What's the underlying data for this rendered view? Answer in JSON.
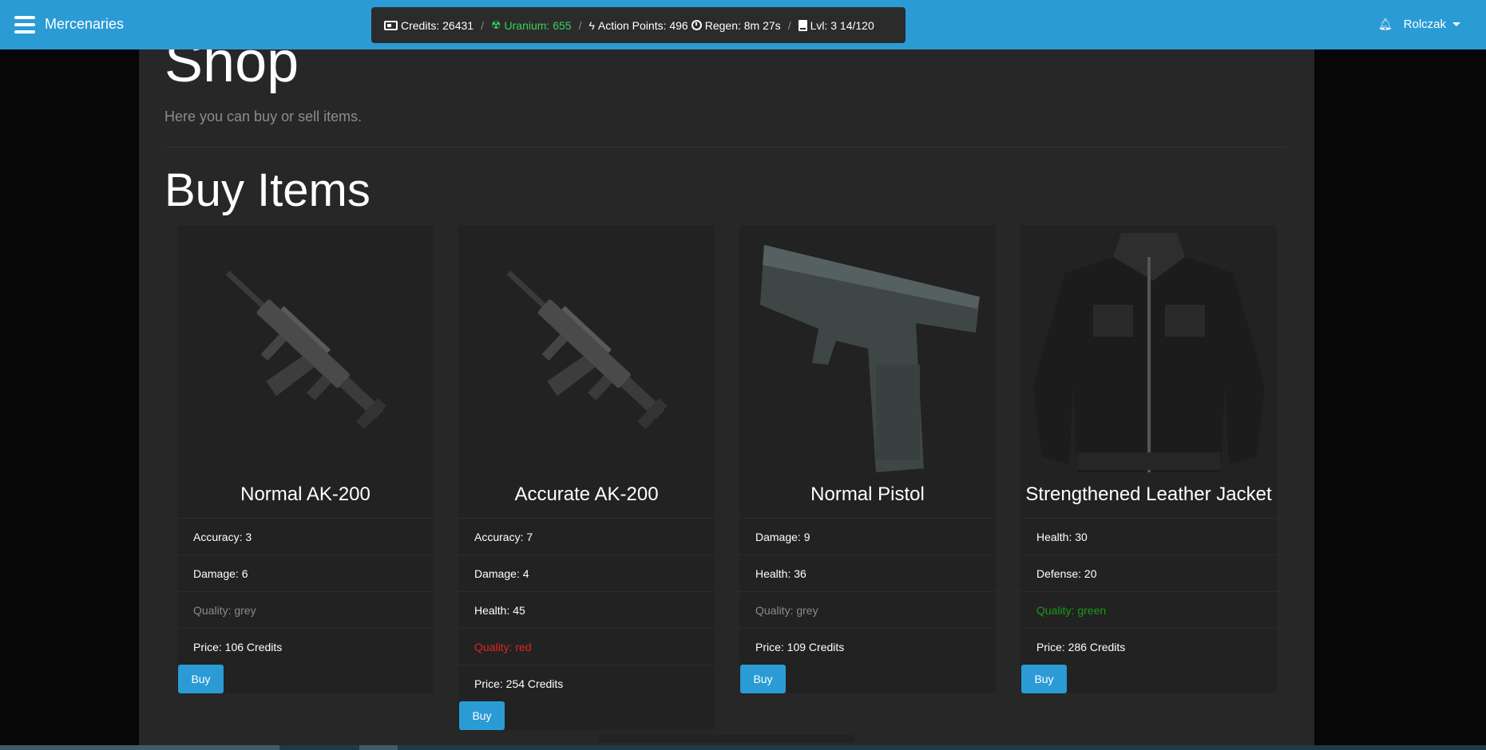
{
  "navbar": {
    "brand": "Mercenaries",
    "stats": {
      "credits": "Credits: 26431",
      "uranium": "Uranium: 655",
      "action_points": "Action Points: 496",
      "regen": "Regen: 8m 27s",
      "level": "Lvl: 3 14/120",
      "separator": "/"
    },
    "user": "Rolczak",
    "colors": {
      "navbar": "#2b9bd6",
      "uranium": "#35d35a"
    }
  },
  "page": {
    "title": "Shop",
    "subtitle": "Here you can buy or sell items.",
    "section_title": "Buy Items"
  },
  "items": [
    {
      "name": "Normal AK-200",
      "image_icon": "assault-rifle-icon",
      "rows": [
        "Accuracy: 3",
        "Damage: 6",
        "Quality: grey",
        "Price: 106 Credits"
      ],
      "button": "Buy"
    },
    {
      "name": "Accurate AK-200",
      "image_icon": "assault-rifle-icon",
      "rows": [
        "Accuracy: 7",
        "Damage: 4",
        "Health: 45",
        "Quality: red",
        "Price: 254 Credits"
      ],
      "button": "Buy"
    },
    {
      "name": "Normal Pistol",
      "image_icon": "pistol-icon",
      "rows": [
        "Damage: 9",
        "Health: 36",
        "Quality: grey",
        "Price: 109 Credits"
      ],
      "button": "Buy"
    },
    {
      "name": "Strengthened Leather Jacket",
      "image_icon": "leather-jacket-icon",
      "rows": [
        "Health: 30",
        "Defense: 20",
        "Quality: green",
        "Price: 286 Credits"
      ],
      "button": "Buy"
    }
  ]
}
